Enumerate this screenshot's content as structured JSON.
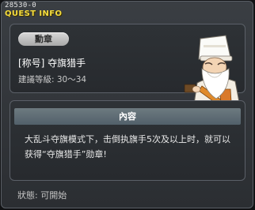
{
  "window": {
    "quest_id": "28530-0",
    "title": "QUEST INFO"
  },
  "quest": {
    "category_badge": "勳章",
    "name": "[称号] 夺旗猎手",
    "required_level": "建議等級: 30～34"
  },
  "content": {
    "header": "內容",
    "text": "大乱斗夺旗模式下，击倒执旗手5次及以上时，就可以获得“夺旗猎手”勋章!"
  },
  "status": {
    "text": "狀態: 可開始"
  },
  "npc": {
    "icon": "sage-npc-icon"
  },
  "colors": {
    "title": "#f4dc3e",
    "panel_border": "#5b6068",
    "header_bg": "#5f6d74"
  }
}
